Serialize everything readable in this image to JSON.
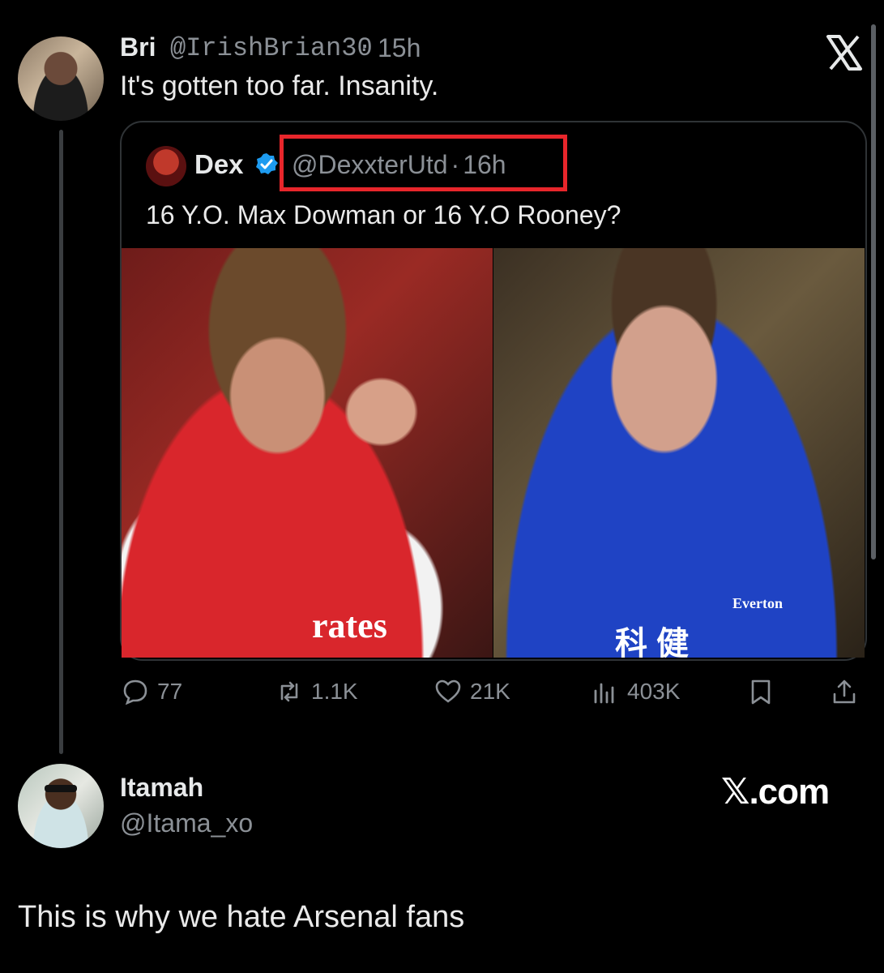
{
  "tweet": {
    "author_name": "Bri",
    "author_handle": "@IrishBrian30",
    "separator": "·",
    "time": "15h",
    "text": "It's gotten too far. Insanity."
  },
  "quoted_tweet": {
    "author_name": "Dex",
    "author_handle": "@DexxterUtd",
    "separator": "·",
    "time": "16h",
    "text": "16 Y.O. Max Dowman or 16 Y.O Rooney?",
    "image_left_text": "rates",
    "image_right_brand": "Everton",
    "image_right_sponsor": "科 健"
  },
  "actions": {
    "replies": "77",
    "reposts": "1.1K",
    "likes": "21K",
    "views": "403K"
  },
  "reply_account": {
    "name": "Itamah",
    "handle": "@Itama_xo",
    "site": "𝕏.com"
  },
  "caption": "This is why we hate Arsenal fans",
  "colors": {
    "background": "#000000",
    "highlight_box": "#e8262b",
    "verified": "#1d9bf0",
    "muted_text": "#8b9096"
  },
  "icons": [
    "x-logo-icon",
    "verified-badge-icon",
    "reply-icon",
    "repost-icon",
    "like-icon",
    "views-icon",
    "bookmark-icon",
    "share-icon"
  ]
}
